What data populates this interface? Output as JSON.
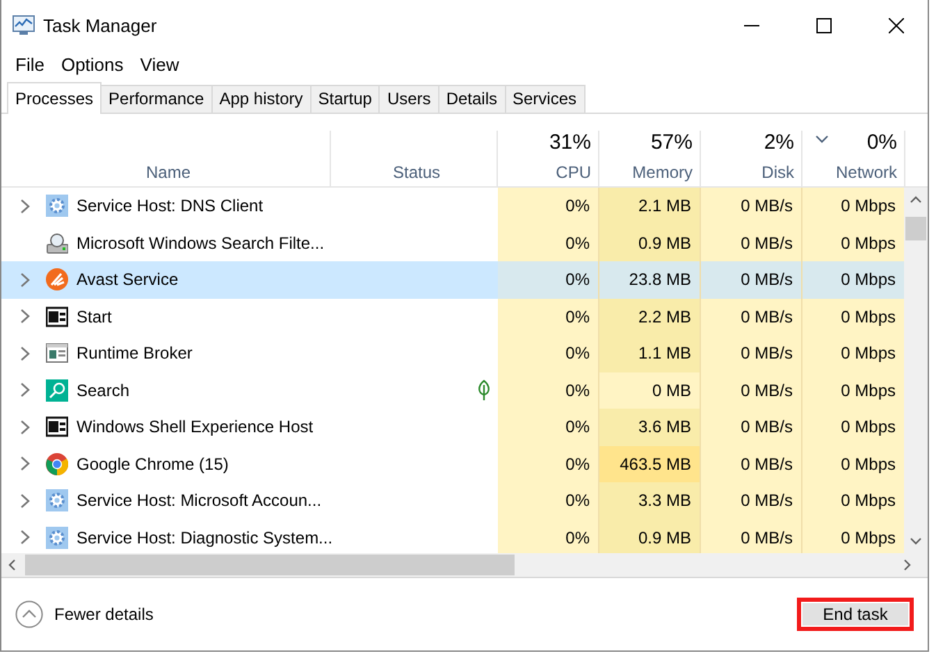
{
  "window": {
    "title": "Task Manager"
  },
  "menu": [
    {
      "label": "File"
    },
    {
      "label": "Options"
    },
    {
      "label": "View"
    }
  ],
  "tabs": [
    {
      "label": "Processes",
      "selected": true
    },
    {
      "label": "Performance",
      "selected": false
    },
    {
      "label": "App history",
      "selected": false
    },
    {
      "label": "Startup",
      "selected": false
    },
    {
      "label": "Users",
      "selected": false
    },
    {
      "label": "Details",
      "selected": false
    },
    {
      "label": "Services",
      "selected": false
    }
  ],
  "table": {
    "columns": [
      {
        "label": "Name",
        "sorted": false
      },
      {
        "label": "Status",
        "sorted": false
      },
      {
        "label": "CPU",
        "total": "31%",
        "sorted": false
      },
      {
        "label": "Memory",
        "total": "57%",
        "sorted": false
      },
      {
        "label": "Disk",
        "total": "2%",
        "sorted": false
      },
      {
        "label": "Network",
        "total": "0%",
        "sorted": true
      }
    ],
    "rows": [
      {
        "kind": "gear",
        "name": "Service Host: DNS Client",
        "expandable": true,
        "selected": false,
        "eco": false,
        "cpu": "0%",
        "memory": {
          "text": "2.1 MB",
          "color": "#f9ecaa"
        },
        "disk": "0 MB/s",
        "network": "0 Mbps"
      },
      {
        "kind": "search-drive",
        "name": "Microsoft Windows Search Filte...",
        "expandable": false,
        "selected": false,
        "eco": false,
        "cpu": "0%",
        "memory": {
          "text": "0.9 MB",
          "color": "#f9ecaa"
        },
        "disk": "0 MB/s",
        "network": "0 Mbps"
      },
      {
        "kind": "avast",
        "name": "Avast Service",
        "expandable": true,
        "selected": true,
        "eco": false,
        "cpu": "0%",
        "memory": {
          "text": "23.8 MB"
        },
        "disk": "0 MB/s",
        "network": "0 Mbps"
      },
      {
        "kind": "window",
        "name": "Start",
        "expandable": true,
        "selected": false,
        "eco": false,
        "cpu": "0%",
        "memory": {
          "text": "2.2 MB",
          "color": "#f9ecaa"
        },
        "disk": "0 MB/s",
        "network": "0 Mbps"
      },
      {
        "kind": "app",
        "name": "Runtime Broker",
        "expandable": true,
        "selected": false,
        "eco": false,
        "cpu": "0%",
        "memory": {
          "text": "1.1 MB",
          "color": "#f9ecaa"
        },
        "disk": "0 MB/s",
        "network": "0 Mbps"
      },
      {
        "kind": "search",
        "name": "Search",
        "expandable": true,
        "selected": false,
        "eco": true,
        "cpu": "0%",
        "memory": {
          "text": "0 MB",
          "color": "#fff4c4"
        },
        "disk": "0 MB/s",
        "network": "0 Mbps"
      },
      {
        "kind": "window",
        "name": "Windows Shell Experience Host",
        "expandable": true,
        "selected": false,
        "eco": false,
        "cpu": "0%",
        "memory": {
          "text": "3.6 MB",
          "color": "#f9ecaa"
        },
        "disk": "0 MB/s",
        "network": "0 Mbps"
      },
      {
        "kind": "chrome",
        "name": "Google Chrome (15)",
        "expandable": true,
        "selected": false,
        "eco": false,
        "cpu": "0%",
        "memory": {
          "text": "463.5 MB",
          "color": "#ffe48c"
        },
        "disk": "0 MB/s",
        "network": "0 Mbps"
      },
      {
        "kind": "gear",
        "name": "Service Host: Microsoft Accoun...",
        "expandable": true,
        "selected": false,
        "eco": false,
        "cpu": "0%",
        "memory": {
          "text": "3.3 MB",
          "color": "#f9ecaa"
        },
        "disk": "0 MB/s",
        "network": "0 Mbps"
      },
      {
        "kind": "gear",
        "name": "Service Host: Diagnostic System...",
        "expandable": true,
        "selected": false,
        "eco": false,
        "cpu": "0%",
        "memory": {
          "text": "0.9 MB",
          "color": "#f9ecaa"
        },
        "disk": "0 MB/s",
        "network": "0 Mbps"
      }
    ]
  },
  "footer": {
    "details_label": "Fewer details",
    "end_button": {
      "label": "End task",
      "highlighted": true
    }
  }
}
